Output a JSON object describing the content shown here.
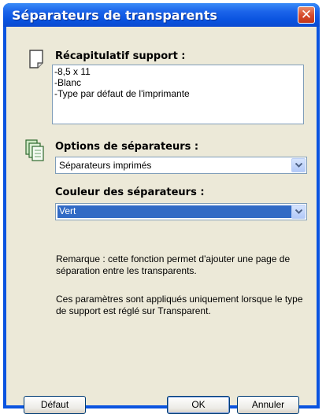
{
  "window": {
    "title": "Séparateurs de transparents"
  },
  "summary": {
    "heading": "Récapitulatif support :",
    "lines": [
      "-8,5 x 11",
      "-Blanc",
      "-Type par défaut de l'imprimante"
    ]
  },
  "options": {
    "heading": "Options de séparateurs :",
    "selected": "Séparateurs imprimés"
  },
  "color": {
    "heading": "Couleur des séparateurs :",
    "selected": "Vert"
  },
  "notes": {
    "note1": "Remarque : cette fonction permet d'ajouter une page de séparation entre les transparents.",
    "note2": "Ces paramètres sont appliqués uniquement lorsque le type de support est réglé sur Transparent."
  },
  "buttons": {
    "default": "Défaut",
    "ok": "OK",
    "cancel": "Annuler"
  },
  "icons": {
    "close": "close-icon",
    "page": "page-icon",
    "sheets": "sheets-icon",
    "dropdown": "chevron-down-icon"
  }
}
